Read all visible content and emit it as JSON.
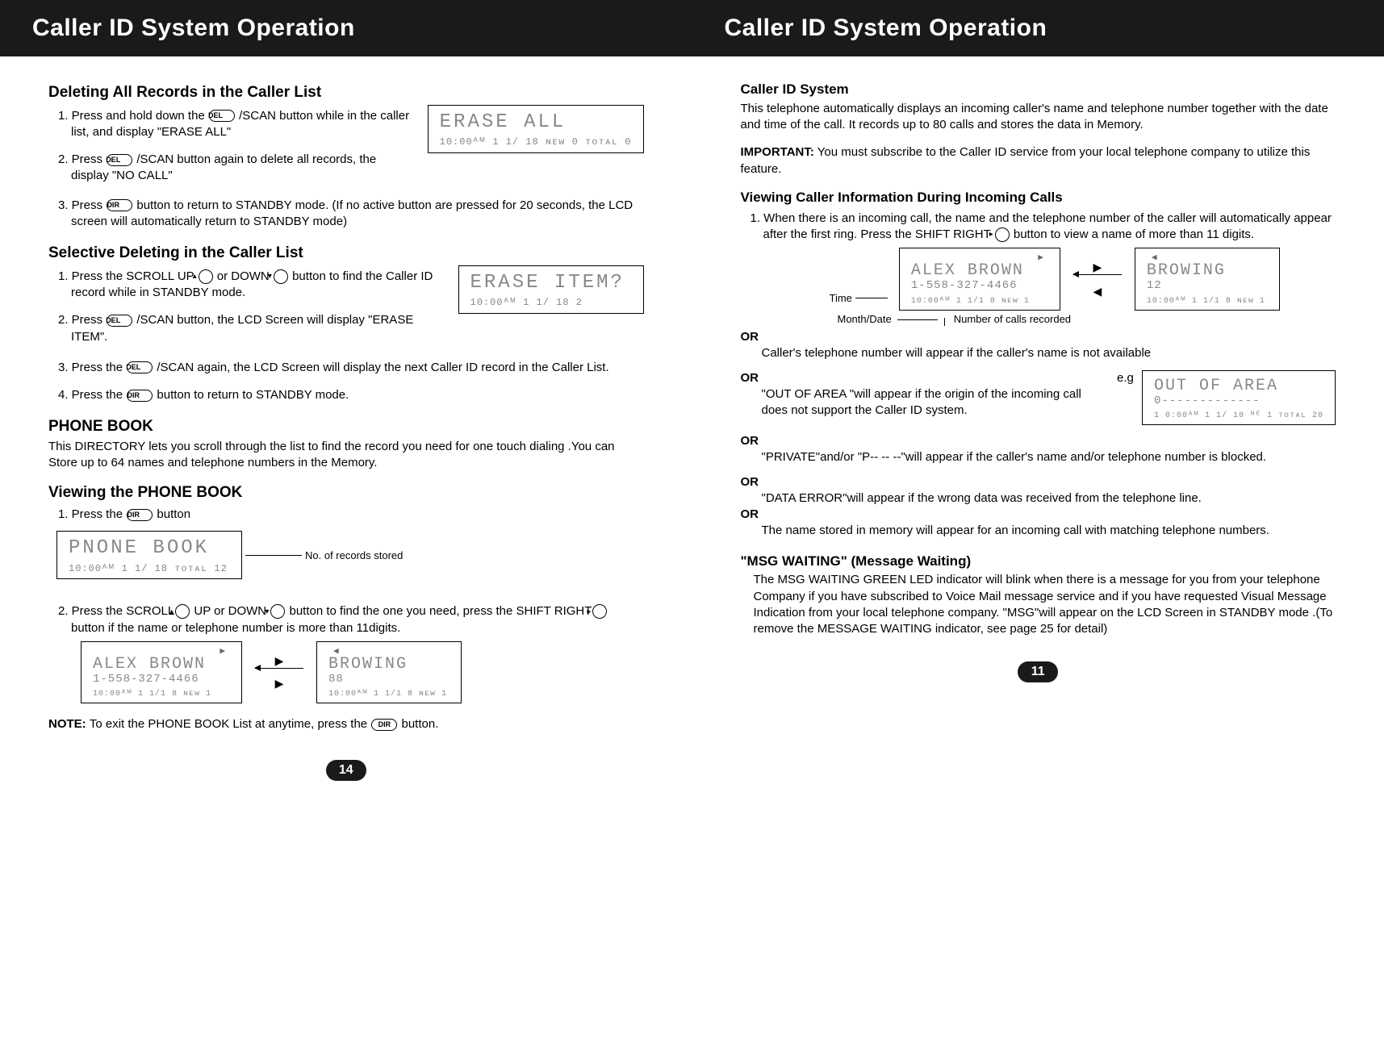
{
  "left": {
    "header": "Caller ID System Operation",
    "sec1_title": "Deleting All Records in the Caller List",
    "sec1_step1_a": "1. Press and hold down the ",
    "sec1_step1_b": " /SCAN button while in the caller list, and display \"ERASE ALL\"",
    "sec1_step2_a": "2. Press ",
    "sec1_step2_b": " /SCAN  button again to delete all records, the display \"NO CALL\"",
    "sec1_step3_a": "3. Press ",
    "sec1_step3_b": "  button to return to STANDBY mode. (If no active button are pressed for 20  seconds, the LCD screen will automatically return to STANDBY mode)",
    "lcd_erase_all_l1": "ERASE ALL",
    "lcd_erase_all_l3": "10:00ᴬᴹ 1 1/ 18 ɴᴇᴡ 0 ᴛᴏᴛᴀʟ 0",
    "sec2_title": "Selective Deleting in the Caller List",
    "sec2_step1_a": "1. Press the SCROLL UP ",
    "sec2_step1_b": " or DOWN ",
    "sec2_step1_c": " button to find the Caller ID record while in STANDBY mode.",
    "sec2_step2_a": "2. Press ",
    "sec2_step2_b": " /SCAN  button,  the LCD Screen will display  \"ERASE ITEM\".",
    "sec2_step3_a": "3. Press the ",
    "sec2_step3_b": " /SCAN  again, the LCD Screen will display the next Caller ID record in the Caller List.",
    "sec2_step4_a": "4. Press the ",
    "sec2_step4_b": " button to return to STANDBY mode.",
    "lcd_erase_item_l1": "ERASE ITEM?",
    "lcd_erase_item_l3": "10:00ᴬᴹ 1 1/ 18   2",
    "sec3_title": "PHONE BOOK",
    "sec3_desc": "This DIRECTORY lets you scroll through the list to find the record you need for one touch dialing .You can Store up to 64 names and telephone numbers in the Memory.",
    "sec4_title": "Viewing the PHONE BOOK",
    "sec4_step1_a": "1. Press the ",
    "sec4_step1_b": " button",
    "lcd_phonebook_l1": "PNONE BOOK",
    "lcd_phonebook_l3": "10:00ᴬᴹ 1 1/ 18    ᴛᴏᴛᴀʟ 12",
    "lcd_phonebook_annot": "No. of records stored",
    "sec4_step2_a": "2. Press the SCROLL",
    "sec4_step2_b": " UP or DOWN ",
    "sec4_step2_c": " button to find the one you need, press the SHIFT RIGHT",
    "sec4_step2_d": " button if the name or telephone number is more than 11digits.",
    "lcd_alex_l1": "ALEX BROWN",
    "lcd_alex_l2": "1-558-327-4466",
    "lcd_alex_l3": "10:00ᴬᴹ 1 1/1 8 ɴᴇᴡ 1",
    "lcd_browing_l1": "BROWING",
    "lcd_browing_l2": "88",
    "lcd_browing_l3": "10:00ᴬᴹ 1 1/1 8 ɴᴇᴡ 1",
    "note_a": "NOTE: ",
    "note_b": "To exit the PHONE BOOK List at anytime, press the ",
    "note_c": "  button.",
    "page_num": "14",
    "btn_del": "DEL",
    "btn_dir": "DIR",
    "btn_up": "▴",
    "btn_down": "▾",
    "btn_right": "▸"
  },
  "right": {
    "header": "Caller ID System Operation",
    "sec1_title": "Caller ID System",
    "sec1_desc": "This telephone automatically displays an incoming caller's name and telephone number together with the date and time of the call. It records up to 80 calls and stores the data in Memory.",
    "important_a": "IMPORTANT:",
    "important_b": " You must subscribe to the Caller ID service from your local telephone company to utilize this feature.",
    "sec2_title": "Viewing Caller Information During Incoming Calls",
    "sec2_step1_a": "1. When there is an incoming call, the name and the telephone number of the caller will automatically appear after the first ring. Press the SHIFT RIGHT ",
    "sec2_step1_b": "   button to view a name of more than 11 digits.",
    "lcd_alex_l1": "ALEX BROWN",
    "lcd_alex_l2": "1-558-327-4466",
    "lcd_alex_l3": "10:00ᴬᴹ 1 1/1 8 ɴᴇᴡ 1",
    "lcd_browing_l1": "BROWING",
    "lcd_browing_l2": "12",
    "lcd_browing_l3": "10:00ᴬᴹ 1 1/1 8 ɴᴇᴡ 1",
    "annot_time": "Time",
    "annot_month": "Month/Date",
    "annot_calls": "Number of calls recorded",
    "or": "OR",
    "or1_text": "Caller's telephone number will appear if the caller's name is not available",
    "or2_text": "\"OUT OF AREA \"will appear if the origin of the incoming call does not support the Caller ID system.",
    "eg": "e.g",
    "lcd_oof_l1": "OUT OF AREA",
    "lcd_oof_l2": "0-------------",
    "lcd_oof_l3": "1 0:00ᴬᴹ 1 1/ 10  ᴺᴱ 1  ᴛᴏᴛᴀʟ 20",
    "or3_text": "\"PRIVATE\"and/or \"P-- -- --\"will appear if the caller's name and/or telephone number is blocked.",
    "or4_text": "\"DATA ERROR\"will appear if the wrong data was received from the telephone line.",
    "or5_text": "The name stored in memory will appear for an incoming call with matching telephone numbers.",
    "sec3_title": "\"MSG WAITING\" (Message Waiting)",
    "sec3_desc": "The MSG WAITING GREEN LED indicator will blink when there is a message for you from your telephone Company if you have subscribed to Voice Mail message service and if you have requested Visual Message Indication from your local telephone company. \"MSG\"will appear on the LCD Screen in STANDBY mode .(To remove the MESSAGE WAITING indicator, see page 25 for detail)",
    "page_num": "11"
  }
}
